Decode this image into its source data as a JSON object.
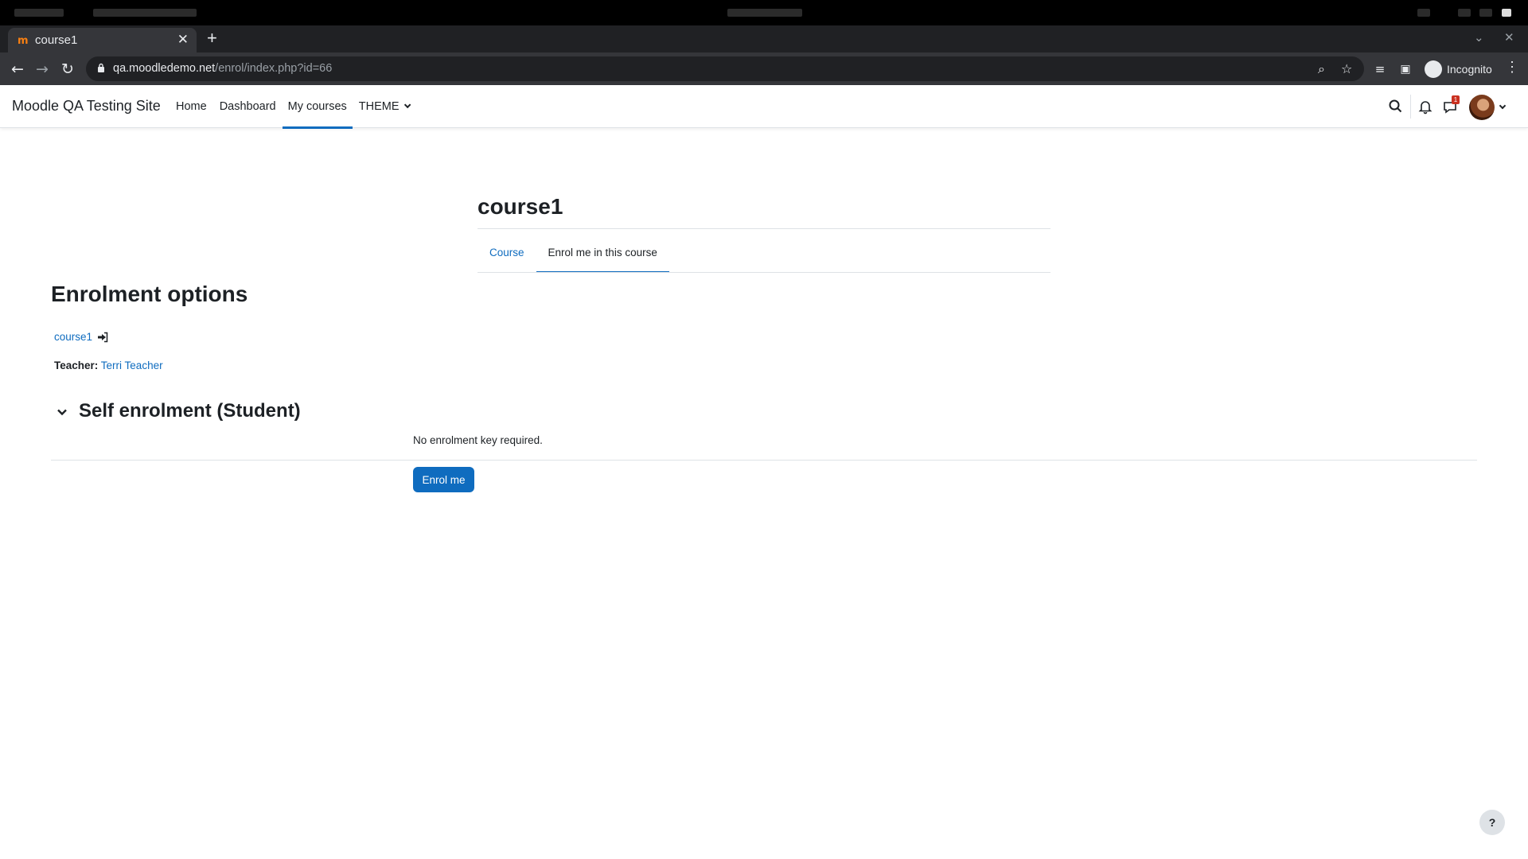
{
  "browser": {
    "tab_title": "course1",
    "tab_favicon": "moodle-favicon",
    "new_tab": "+",
    "url_host": "qa.moodledemo.net",
    "url_path": "/enrol/index.php?id=66",
    "incognito_label": "Incognito"
  },
  "navbar": {
    "site_name": "Moodle QA Testing Site",
    "items": [
      {
        "label": "Home",
        "active": false
      },
      {
        "label": "Dashboard",
        "active": false
      },
      {
        "label": "My courses",
        "active": true
      },
      {
        "label": "THEME",
        "active": false
      }
    ],
    "message_badge": "1",
    "icons": [
      "search-icon",
      "bell-icon",
      "chat-icon",
      "avatar"
    ]
  },
  "header": {
    "title": "course1",
    "tabs": [
      {
        "label": "Course",
        "active": false
      },
      {
        "label": "Enrol me in this course",
        "active": true
      }
    ]
  },
  "main": {
    "heading": "Enrolment options",
    "course_link": "course1",
    "teacher_label": "Teacher:",
    "teacher_name": "Terri Teacher",
    "method_heading": "Self enrolment (Student)",
    "no_key_text": "No enrolment key required.",
    "enrol_button": "Enrol me"
  },
  "help": "?",
  "colors": {
    "primary": "#0f6cbf",
    "text": "#1d2125",
    "badge": "#ca3120"
  }
}
